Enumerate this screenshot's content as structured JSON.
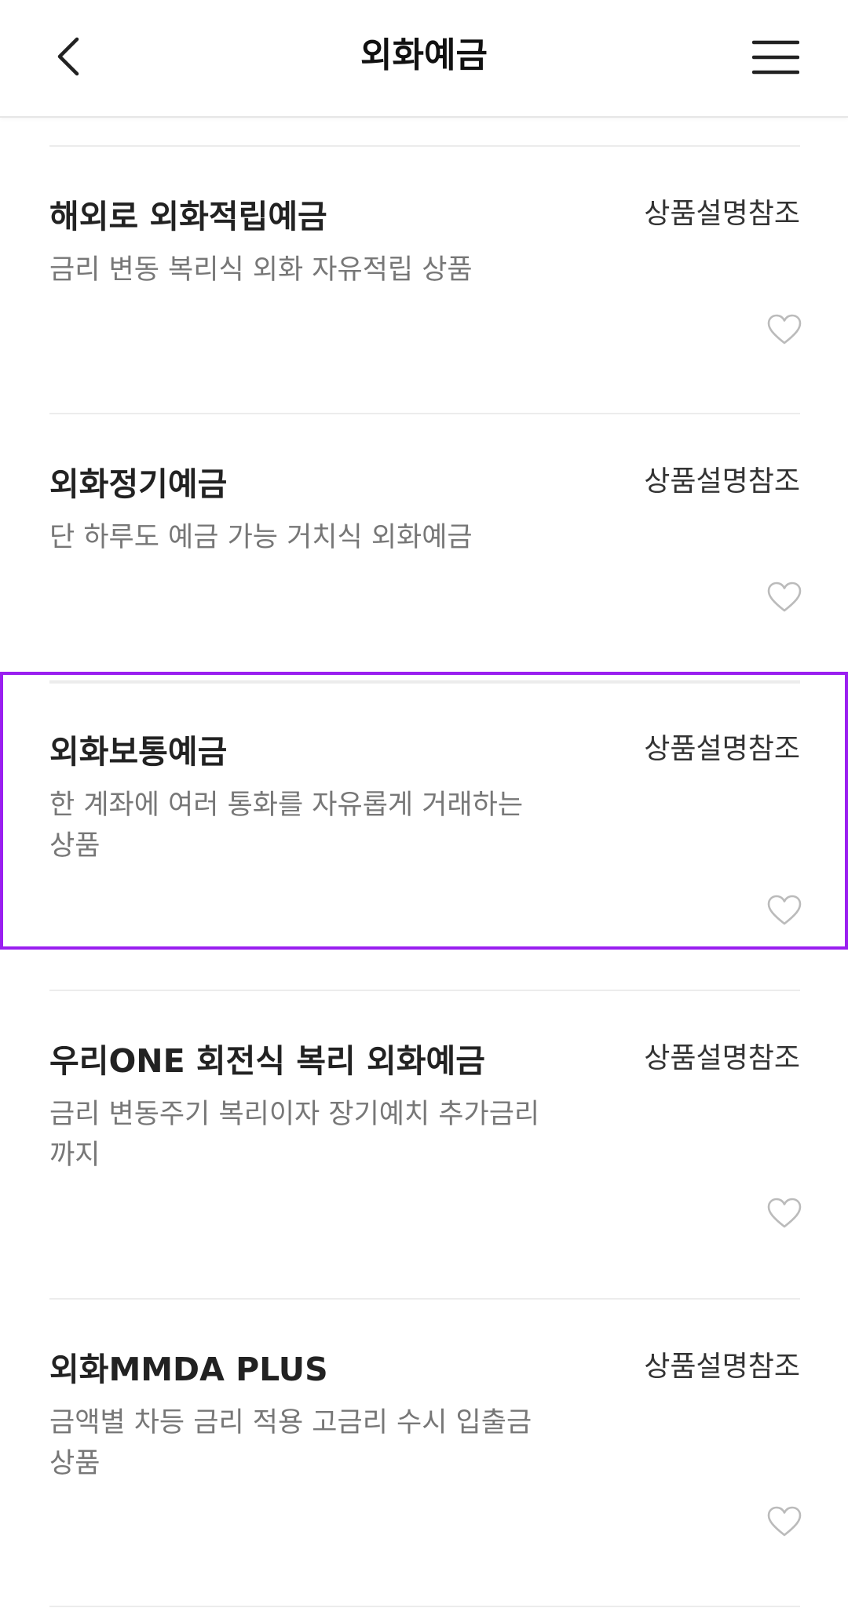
{
  "header": {
    "title": "외화예금",
    "back_icon": "chevron-left-icon",
    "menu_icon": "hamburger-menu-icon"
  },
  "products": [
    {
      "name": "해외로 외화적립예금",
      "rate": "상품설명참조",
      "description": "금리 변동 복리식 외화 자유적립 상품",
      "favorite": false
    },
    {
      "name": "외화정기예금",
      "rate": "상품설명참조",
      "description": "단 하루도 예금 가능 거치식 외화예금",
      "favorite": false
    },
    {
      "name": "외화보통예금",
      "rate": "상품설명참조",
      "description": "한 계좌에 여러 통화를 자유롭게 거래하는 상품",
      "favorite": false,
      "selected": true
    },
    {
      "name": "우리ONE 회전식 복리 외화예금",
      "rate": "상품설명참조",
      "description": "금리 변동주기 복리이자 장기예치 추가금리까지",
      "favorite": false
    },
    {
      "name": "외화MMDA PLUS",
      "rate": "상품설명참조",
      "description": "금액별 차등 금리 적용 고금리 수시 입출금 상품",
      "favorite": false
    }
  ],
  "colors": {
    "selection_border": "#9a1ff0",
    "description_text": "#777777",
    "heart_outline": "#bbbbbb"
  }
}
